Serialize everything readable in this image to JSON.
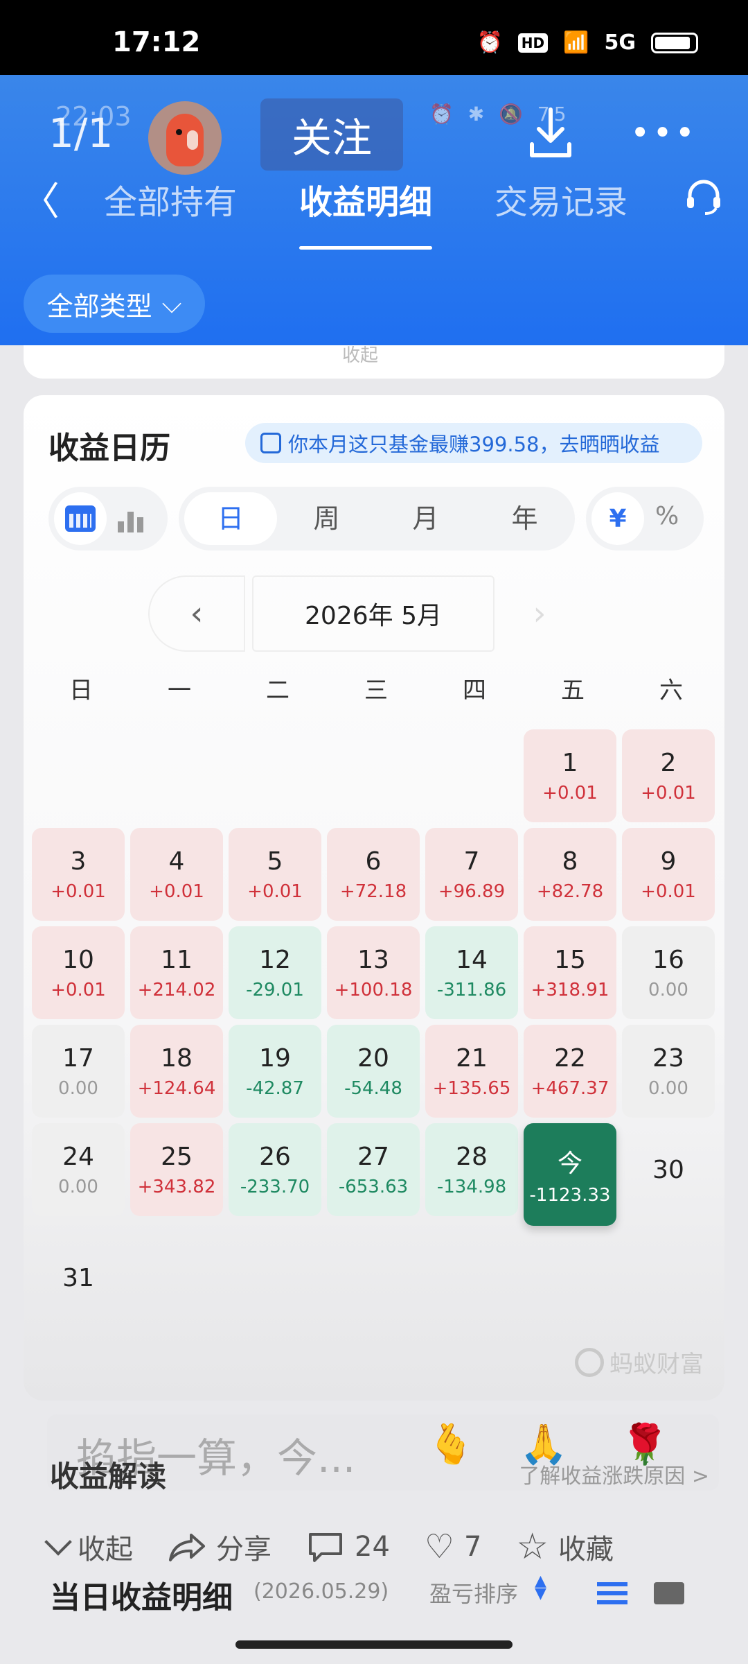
{
  "status_bar": {
    "time": "17:12",
    "hd": "HD",
    "network": "5G"
  },
  "viewer": {
    "ghost_time": "22:03",
    "photo_count": "1/1",
    "follow_label": "关注",
    "ghost_battery": "75"
  },
  "header": {
    "tabs": [
      {
        "label": "全部持有",
        "active": false
      },
      {
        "label": "收益明细",
        "active": true
      },
      {
        "label": "交易记录",
        "active": false
      }
    ],
    "filter_label": "全部类型"
  },
  "top_card_hint": "收起",
  "calendar": {
    "title": "收益日历",
    "promo": "你本月这只基金最赚399.58，去晒晒收益",
    "periods": [
      "日",
      "周",
      "月",
      "年"
    ],
    "units": [
      "¥",
      "%"
    ],
    "month_label": "2026年 5月",
    "weekdays": [
      "日",
      "一",
      "二",
      "三",
      "四",
      "五",
      "六"
    ],
    "days": [
      {
        "day": "",
        "value": "",
        "type": "blank"
      },
      {
        "day": "",
        "value": "",
        "type": "blank"
      },
      {
        "day": "",
        "value": "",
        "type": "blank"
      },
      {
        "day": "",
        "value": "",
        "type": "blank"
      },
      {
        "day": "",
        "value": "",
        "type": "blank"
      },
      {
        "day": "1",
        "value": "+0.01",
        "type": "up"
      },
      {
        "day": "2",
        "value": "+0.01",
        "type": "up"
      },
      {
        "day": "3",
        "value": "+0.01",
        "type": "up"
      },
      {
        "day": "4",
        "value": "+0.01",
        "type": "up"
      },
      {
        "day": "5",
        "value": "+0.01",
        "type": "up"
      },
      {
        "day": "6",
        "value": "+72.18",
        "type": "up"
      },
      {
        "day": "7",
        "value": "+96.89",
        "type": "up"
      },
      {
        "day": "8",
        "value": "+82.78",
        "type": "up"
      },
      {
        "day": "9",
        "value": "+0.01",
        "type": "up"
      },
      {
        "day": "10",
        "value": "+0.01",
        "type": "up"
      },
      {
        "day": "11",
        "value": "+214.02",
        "type": "up"
      },
      {
        "day": "12",
        "value": "-29.01",
        "type": "down"
      },
      {
        "day": "13",
        "value": "+100.18",
        "type": "up"
      },
      {
        "day": "14",
        "value": "-311.86",
        "type": "down"
      },
      {
        "day": "15",
        "value": "+318.91",
        "type": "up"
      },
      {
        "day": "16",
        "value": "0.00",
        "type": "flat"
      },
      {
        "day": "17",
        "value": "0.00",
        "type": "flat"
      },
      {
        "day": "18",
        "value": "+124.64",
        "type": "up"
      },
      {
        "day": "19",
        "value": "-42.87",
        "type": "down"
      },
      {
        "day": "20",
        "value": "-54.48",
        "type": "down"
      },
      {
        "day": "21",
        "value": "+135.65",
        "type": "up"
      },
      {
        "day": "22",
        "value": "+467.37",
        "type": "up"
      },
      {
        "day": "23",
        "value": "0.00",
        "type": "flat"
      },
      {
        "day": "24",
        "value": "0.00",
        "type": "flat"
      },
      {
        "day": "25",
        "value": "+343.82",
        "type": "up"
      },
      {
        "day": "26",
        "value": "-233.70",
        "type": "down"
      },
      {
        "day": "27",
        "value": "-653.63",
        "type": "down"
      },
      {
        "day": "28",
        "value": "-134.98",
        "type": "down"
      },
      {
        "day": "今",
        "value": "-1123.33",
        "type": "today"
      },
      {
        "day": "30",
        "value": "",
        "type": "future"
      },
      {
        "day": "31",
        "value": "",
        "type": "future"
      }
    ],
    "watermark": "蚂蚁财富"
  },
  "comment": {
    "draft": "掐指一算，今...",
    "emojis": [
      "🫰",
      "🙏",
      "🌹"
    ]
  },
  "interpretation": {
    "title": "收益解读",
    "link": "了解收益涨跌原因 >"
  },
  "actions": {
    "collapse": "收起",
    "share": "分享",
    "comments": "24",
    "likes": "7",
    "favorite": "收藏"
  },
  "daily_detail": {
    "title": "当日收益明细",
    "date": "(2026.05.29)",
    "sort_label": "盈亏排序"
  },
  "colors": {
    "header_blue": "#1f6ff0",
    "gain_red": "#d0313a",
    "loss_green": "#1f8a62",
    "today_green": "#1d7d5b"
  }
}
